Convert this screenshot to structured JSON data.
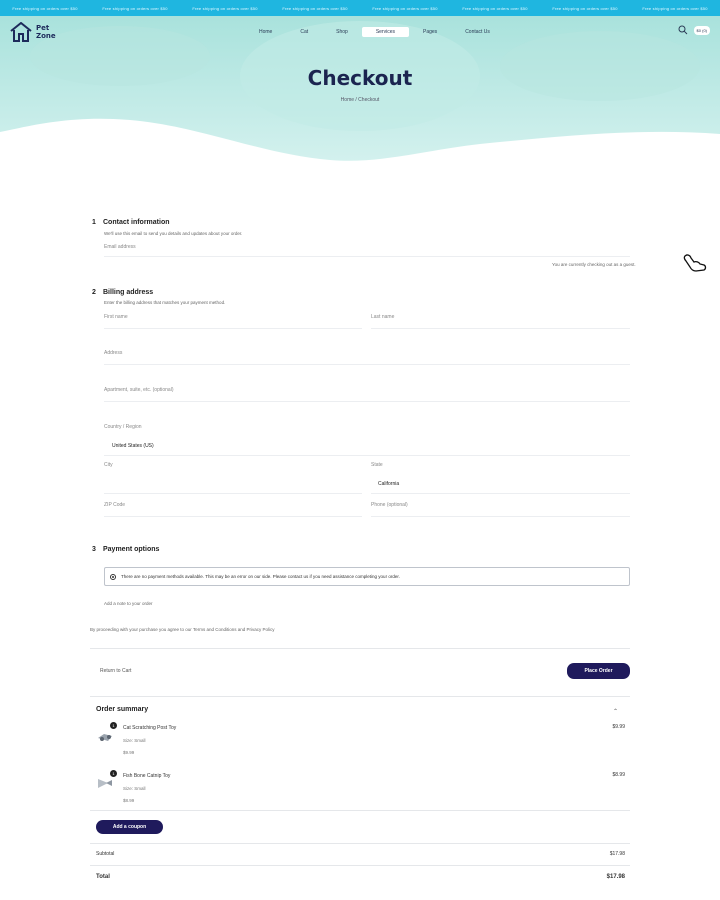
{
  "announcement": {
    "messages": [
      "Free shipping on orders over $50",
      "Free shipping on orders over $50",
      "Free shipping on orders over $50",
      "Free shipping on orders over $50",
      "Free shipping on orders over $50",
      "Free shipping on orders over $50",
      "Free shipping on orders over $50",
      "Free shipping on orders over $50"
    ]
  },
  "header": {
    "logo_line1": "Pet",
    "logo_line2": "Zone",
    "nav": [
      "Home",
      "Cat",
      "Shop",
      "Services",
      "Pages",
      "Contact Us"
    ],
    "cart_label": "$0 (0)"
  },
  "hero": {
    "title": "Checkout",
    "breadcrumb": "Home  /  Checkout"
  },
  "contact": {
    "number": "1",
    "heading": "Contact information",
    "subtitle": "We'll use this email to send you details and updates about your order.",
    "email_label": "Email address",
    "guest_note": "You are currently checking out as a guest."
  },
  "billing": {
    "number": "2",
    "heading": "Billing address",
    "subtitle": "Enter the billing address that matches your payment method.",
    "first_name_label": "First name",
    "last_name_label": "Last name",
    "address_label": "Address",
    "apartment_label": "Apartment, suite, etc. (optional)",
    "country_label": "Country / Region",
    "country_value": "United States (US)",
    "city_label": "City",
    "state_label": "State",
    "state_value": "California",
    "zip_label": "ZIP Code",
    "phone_label": "Phone (optional)"
  },
  "payment": {
    "number": "3",
    "heading": "Payment options",
    "option_text": "There are no payment methods available. This may be an error on our side. Please contact us if you need assistance completing your order.",
    "note_label": "Add a note to your order"
  },
  "terms": {
    "text": "By proceeding with your purchase you agree to our Terms and Conditions and Privacy Policy"
  },
  "actions": {
    "return_label": "Return to Cart",
    "place_order_label": "Place Order"
  },
  "summary": {
    "heading": "Order summary",
    "items": [
      {
        "qty": "1",
        "name": "Cat Scratching Post Toy",
        "meta1": "Size: Small",
        "meta2": "$9.99",
        "price": "$9.99"
      },
      {
        "qty": "1",
        "name": "Fish Bone Catnip Toy",
        "meta1": "Size: Small",
        "meta2": "$8.99",
        "price": "$8.99"
      }
    ],
    "coupon_label": "Add a coupon",
    "subtotal_label": "Subtotal",
    "subtotal_value": "$17.98",
    "total_label": "Total",
    "total_value": "$17.98"
  },
  "colors": {
    "accent": "#1f1a5c",
    "topbar": "#1fb6e0",
    "hero": "#bfe8e4",
    "title": "#1b2450"
  }
}
